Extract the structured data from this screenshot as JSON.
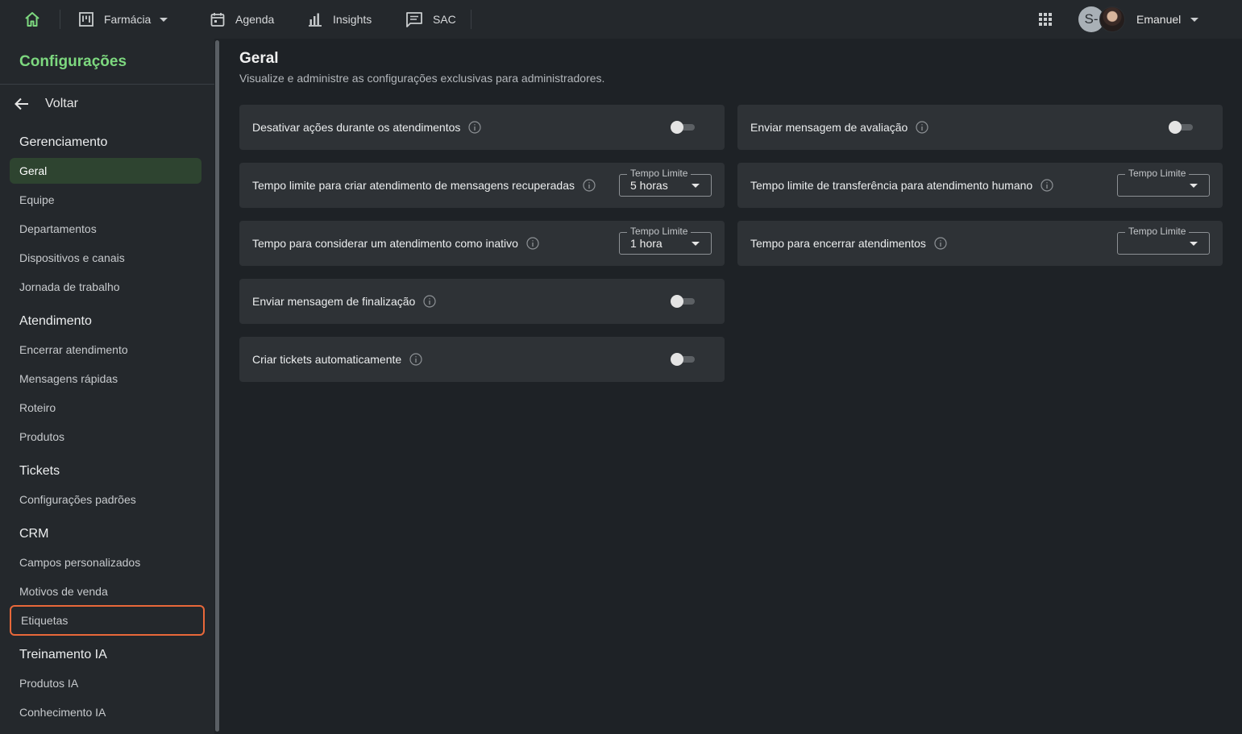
{
  "topbar": {
    "nav": [
      {
        "label": "Farmácia",
        "icon": "kanban-board-icon"
      },
      {
        "label": "Agenda",
        "icon": "calendar-icon"
      },
      {
        "label": "Insights",
        "icon": "bar-chart-icon"
      },
      {
        "label": "SAC",
        "icon": "chat-message-icon"
      }
    ],
    "avatar_initial": "S-",
    "user_name": "Emanuel"
  },
  "sidebar": {
    "title": "Configurações",
    "back_label": "Voltar",
    "sections": [
      {
        "title": "Gerenciamento",
        "items": [
          "Geral",
          "Equipe",
          "Departamentos",
          "Dispositivos e canais",
          "Jornada de trabalho"
        ]
      },
      {
        "title": "Atendimento",
        "items": [
          "Encerrar atendimento",
          "Mensagens rápidas",
          "Roteiro",
          "Produtos"
        ]
      },
      {
        "title": "Tickets",
        "items": [
          "Configurações padrões"
        ]
      },
      {
        "title": "CRM",
        "items": [
          "Campos personalizados",
          "Motivos de venda",
          "Etiquetas"
        ]
      },
      {
        "title": "Treinamento IA",
        "items": [
          "Produtos IA",
          "Conhecimento IA"
        ]
      }
    ],
    "active_item": "Geral",
    "highlighted_item": "Etiquetas"
  },
  "main": {
    "title": "Geral",
    "subtitle": "Visualize e administre as configurações exclusivas para administradores.",
    "settings_left": [
      {
        "label": "Desativar ações durante os atendimentos",
        "control": "toggle",
        "on": false
      },
      {
        "label": "Tempo limite para criar atendimento de mensagens recuperadas",
        "control": "select",
        "legend": "Tempo Limite",
        "value": "5 horas"
      },
      {
        "label": "Tempo para considerar um atendimento como inativo",
        "control": "select",
        "legend": "Tempo Limite",
        "value": "1 hora"
      },
      {
        "label": "Enviar mensagem de finalização",
        "control": "toggle",
        "on": false
      },
      {
        "label": "Criar tickets automaticamente",
        "control": "toggle",
        "on": false
      }
    ],
    "settings_right": [
      {
        "label": "Enviar mensagem de avaliação",
        "control": "toggle",
        "on": false
      },
      {
        "label": "Tempo limite de transferência para atendimento humano",
        "control": "select",
        "legend": "Tempo Limite",
        "value": ""
      },
      {
        "label": "Tempo para encerrar atendimentos",
        "control": "select",
        "legend": "Tempo Limite",
        "value": ""
      }
    ]
  },
  "colors": {
    "accent": "#7dd87f",
    "active_bg": "#2e4430",
    "highlight_border": "#e8683a",
    "background": "#1e2226",
    "panel": "#24282c",
    "card": "#2e3236"
  }
}
